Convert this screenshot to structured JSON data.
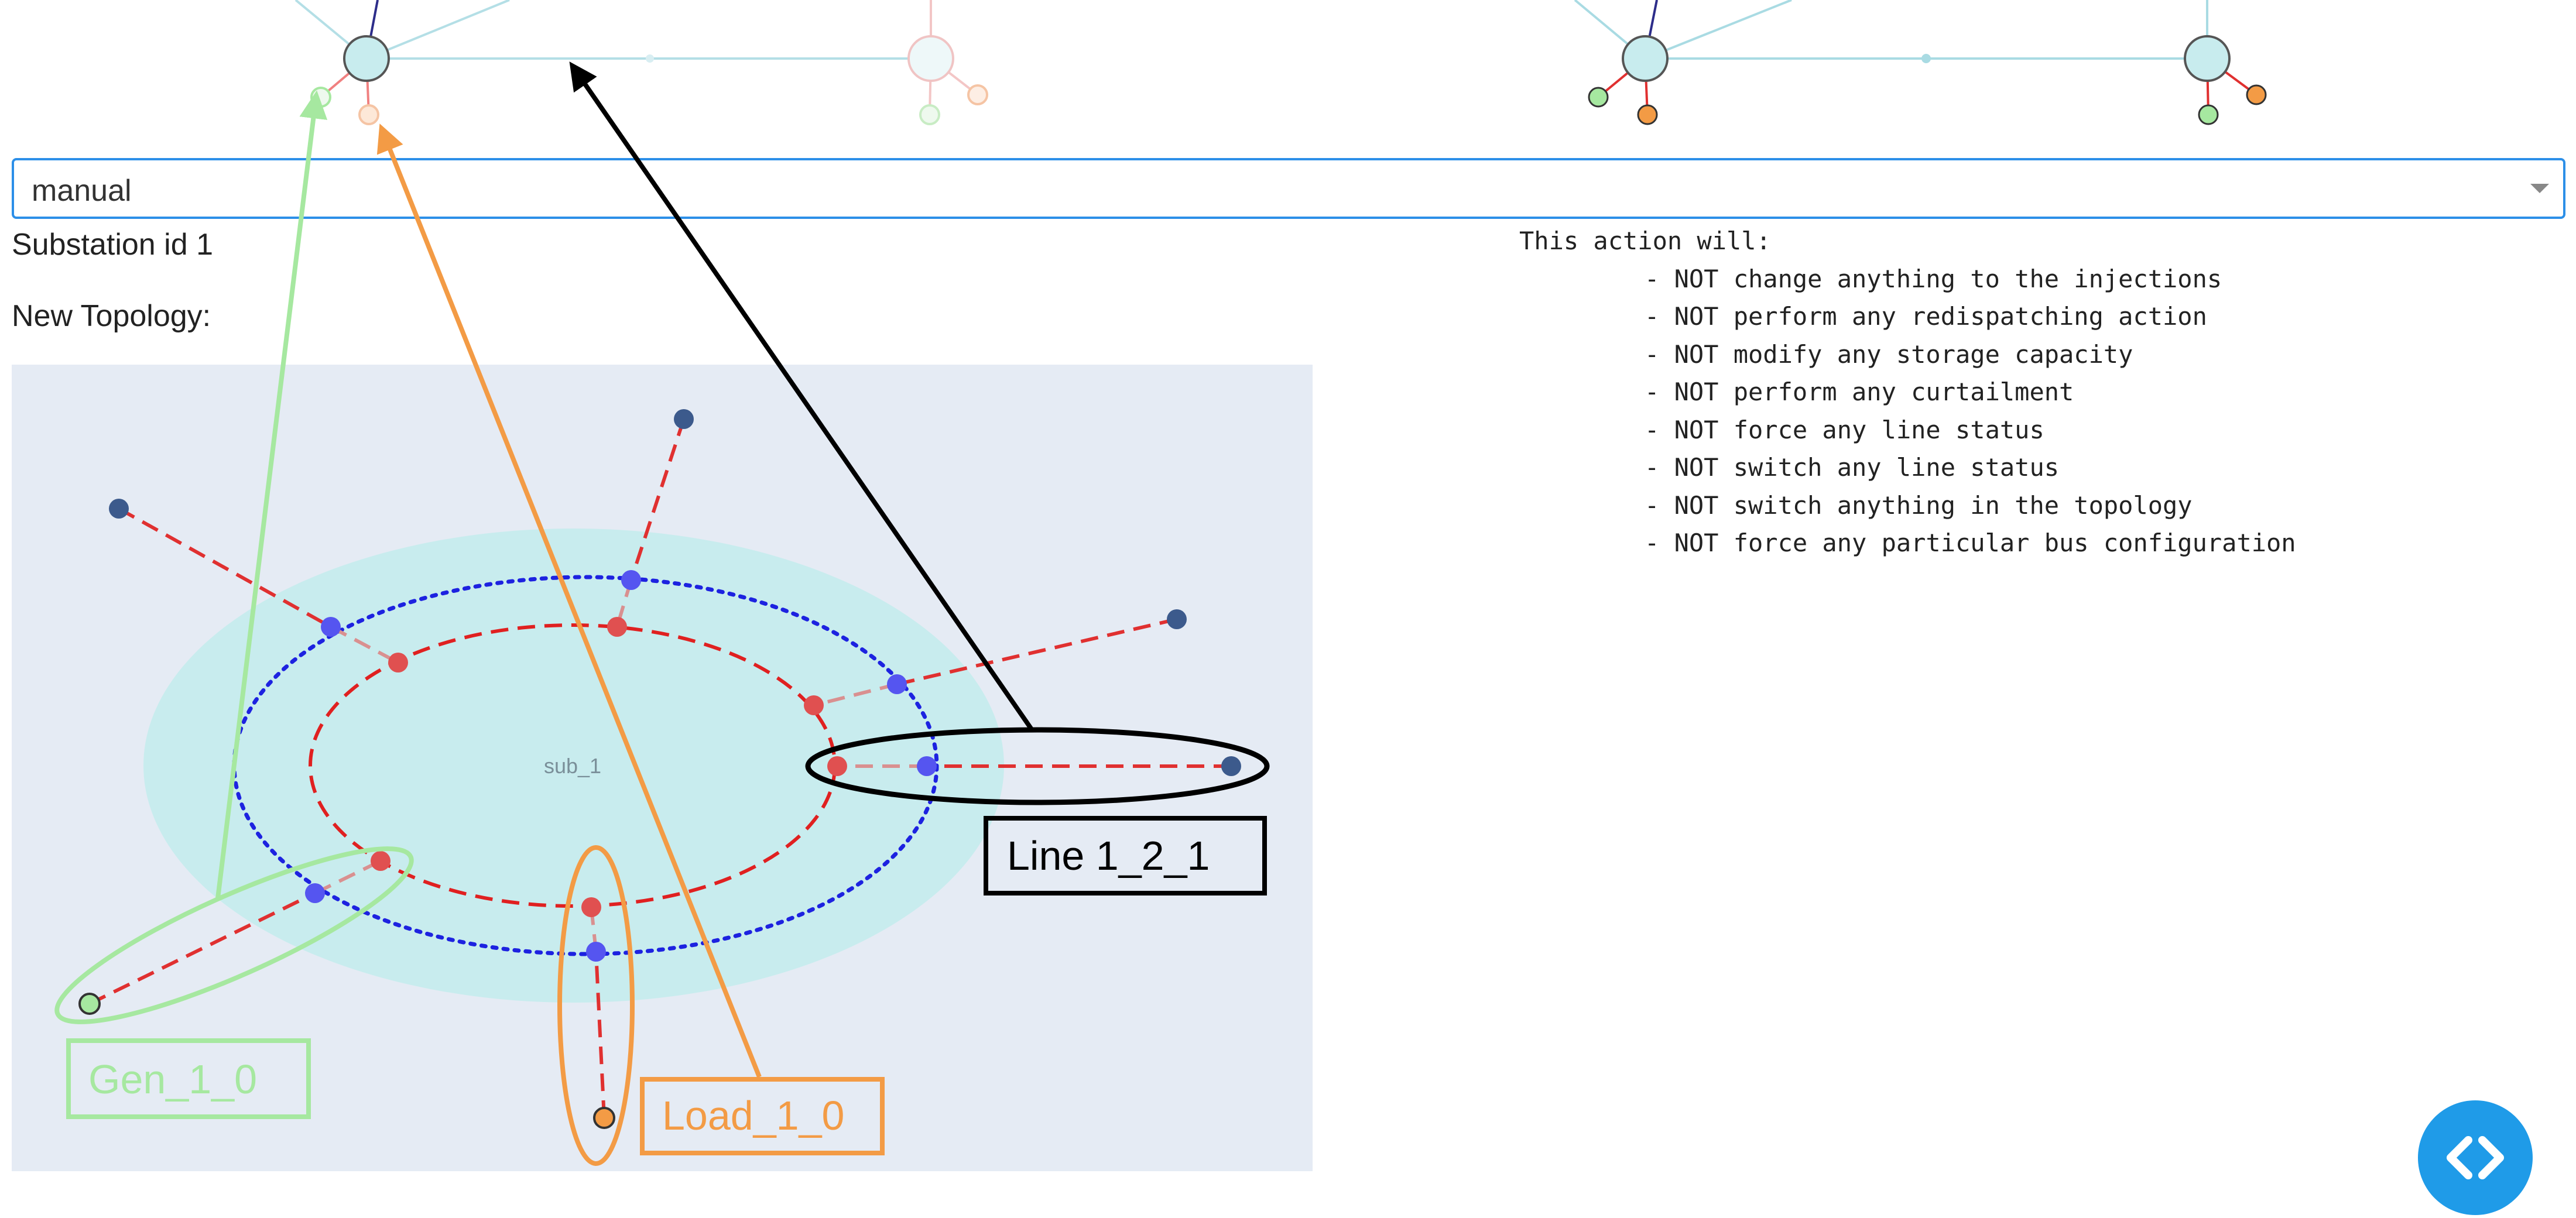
{
  "select": {
    "value": "manual"
  },
  "substation": {
    "label": "Substation id 1"
  },
  "topology": {
    "label": "New Topology:"
  },
  "action_summary": {
    "header": "This action will:",
    "items": [
      "- NOT change anything to the injections",
      "- NOT perform any redispatching action",
      "- NOT modify any storage capacity",
      "- NOT perform any curtailment",
      "- NOT force any line status",
      "- NOT switch any line status",
      "- NOT switch anything in the topology",
      "- NOT force any particular bus configuration"
    ]
  },
  "diagram": {
    "substation_name": "sub_1",
    "callouts": {
      "line": "Line 1_2_1",
      "gen": "Gen_1_0",
      "load": "Load_1_0"
    }
  },
  "colors": {
    "bus1": "#e03030",
    "bus2": "#2020e0",
    "line_element": "#3c5a8c",
    "generator": "#a6e8a0",
    "load": "#f39b45",
    "substation_fill": "#c8ecee",
    "plot_background": "#e5ebf4",
    "fab": "#1f9be8"
  }
}
